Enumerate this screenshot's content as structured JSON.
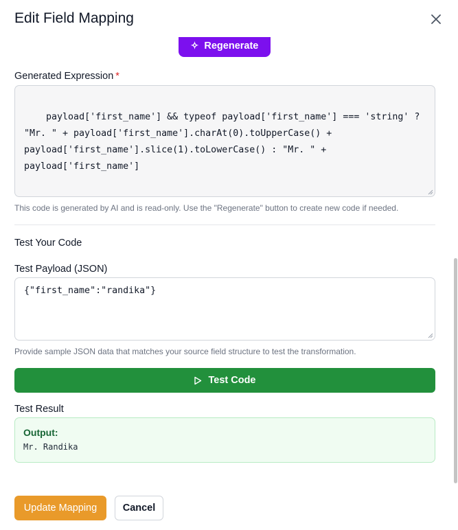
{
  "modal": {
    "title": "Edit Field Mapping"
  },
  "regenerate": {
    "label": "Regenerate"
  },
  "expression": {
    "label": "Generated Expression",
    "required_mark": "*",
    "code": "payload['first_name'] && typeof payload['first_name'] === 'string' ?\n\"Mr. \" + payload['first_name'].charAt(0).toUpperCase() +\npayload['first_name'].slice(1).toLowerCase() : \"Mr. \" +\npayload['first_name']",
    "help": "This code is generated by AI and is read-only. Use the \"Regenerate\" button to create new code if needed."
  },
  "test": {
    "section_title": "Test Your Code",
    "payload_label": "Test Payload (JSON)",
    "payload_value": "{\"first_name\":\"randika\"}",
    "payload_help": "Provide sample JSON data that matches your source field structure to test the transformation.",
    "button_label": "Test Code",
    "result_label": "Test Result",
    "output_label": "Output:",
    "output_value": "Mr. Randika"
  },
  "footer": {
    "update_label": "Update Mapping",
    "cancel_label": "Cancel"
  },
  "colors": {
    "regenerate": "#7c10ee",
    "test_button": "#22903c",
    "update_button": "#e99a2a",
    "required": "#dc2626",
    "output_label": "#166534"
  },
  "icons": {
    "close": "close-icon",
    "regenerate": "sparkle-icon",
    "test": "play-icon"
  }
}
